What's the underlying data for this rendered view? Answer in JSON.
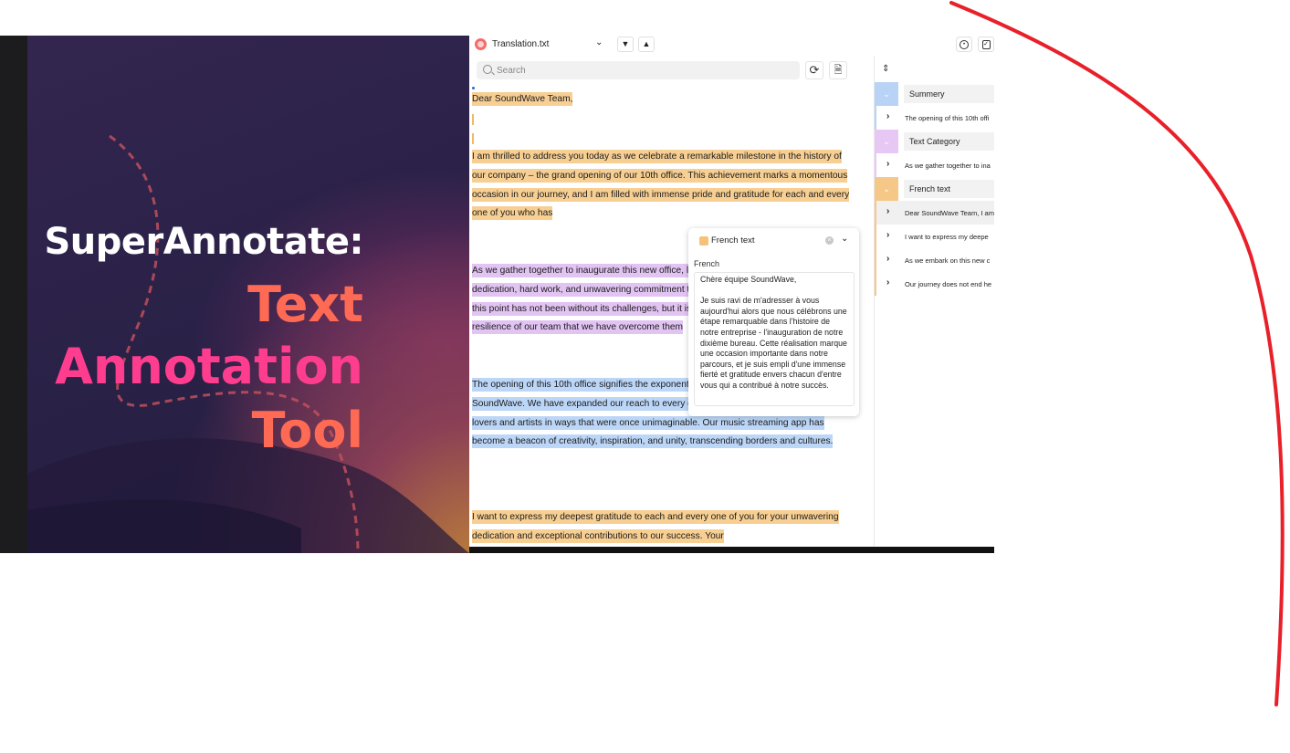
{
  "promo": {
    "line1": "SuperAnnotate:",
    "line2": "Text",
    "line3": "Annotation",
    "line4": "Tool"
  },
  "toolbar": {
    "file_name": "Translation.txt",
    "file_icon": "file-icon",
    "thumbs_down_icon": "thumbs-down-icon",
    "thumbs_up_icon": "thumbs-up-icon"
  },
  "search": {
    "placeholder": "Search"
  },
  "document": {
    "p1": "Dear SoundWave Team,",
    "p4": "I am thrilled to address you today as we celebrate a remarkable milestone in the history of our company – the grand opening of our 10th office. This achievement marks a momentous occasion in our journey, and I am filled with immense pride and gratitude for each and every one of you who has",
    "p5": "As we gather together to inaugurate this new office, let us take a moment to reflect on the dedication, hard work, and unwavering commitment that has brought us here. The road to this point has not been without its challenges, but it is through the perseverance and resilience of our team that we have overcome them",
    "p6": "The opening of this 10th office signifies the exponential growth and global impact of SoundWave. We have expanded our reach to every corner of the world, connecting music lovers and artists in ways that were once unimaginable. Our music streaming app has become a beacon of creativity, inspiration, and unity, transcending borders and cultures.",
    "p7": "I want to express my deepest gratitude to each and every one of you for your unwavering dedication and exceptional contributions to our success. Your"
  },
  "popup": {
    "title": "French text",
    "label": "French",
    "text": "Chère équipe SoundWave,\n\nJe suis ravi de m'adresser à vous aujourd'hui alors que nous célébrons une étape remarquable dans l'histoire de notre entreprise - l'inauguration de notre dixième bureau. Cette réalisation marque une occasion importante dans notre parcours, et je suis empli d'une immense fierté et gratitude envers chacun d'entre vous qui a contribué à notre succès."
  },
  "right_panel": {
    "categories": [
      {
        "name": "Summery"
      },
      {
        "name": "Text Category"
      },
      {
        "name": "French text"
      }
    ],
    "rows": [
      {
        "text": "The opening of this 10th offi"
      },
      {
        "text": "As we gather together to ina"
      },
      {
        "text": "Dear SoundWave Team, I am"
      },
      {
        "text": "I want to express my deepe"
      },
      {
        "text": "As we embark on this new c"
      },
      {
        "text": "Our journey does not end he"
      }
    ]
  },
  "colors": {
    "orange_highlight": "#f7cf93",
    "purple_highlight": "#e2c4f3",
    "blue_highlight": "#bcd6f7",
    "annotation_arc": "#e8202a"
  }
}
